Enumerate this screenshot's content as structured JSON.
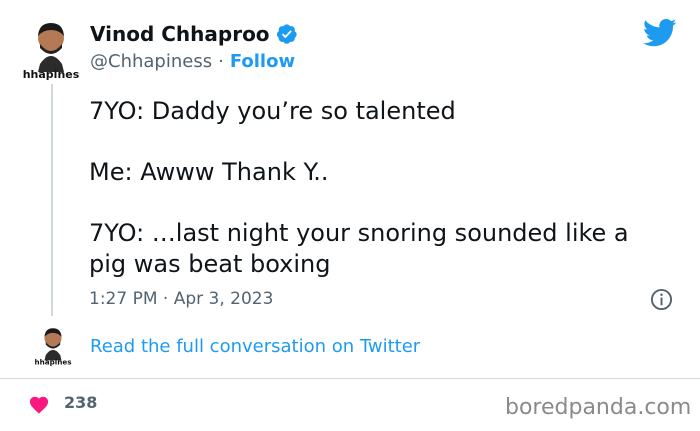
{
  "author": {
    "name": "Vinod Chhaproo",
    "handle": "@Chhapiness",
    "separator": "·",
    "follow_label": "Follow",
    "avatar_caption": "chhapiness"
  },
  "tweet": {
    "lines": [
      "7YO: Daddy you’re so talented",
      "Me: Awww Thank Y..",
      "7YO: …last night your snoring sounded like a",
      "pig was beat boxing"
    ],
    "time": "1:27 PM",
    "date": "Apr 3, 2023"
  },
  "footer": {
    "read_more": "Read the full conversation on Twitter",
    "like_count": "238",
    "watermark": "boredpanda.com"
  },
  "colors": {
    "accent": "#1d9bf0",
    "heart": "#f91880",
    "muted": "#536471",
    "text": "#0f1419"
  },
  "icons": [
    "verified-badge-icon",
    "twitter-bird-icon",
    "info-icon",
    "heart-icon"
  ]
}
